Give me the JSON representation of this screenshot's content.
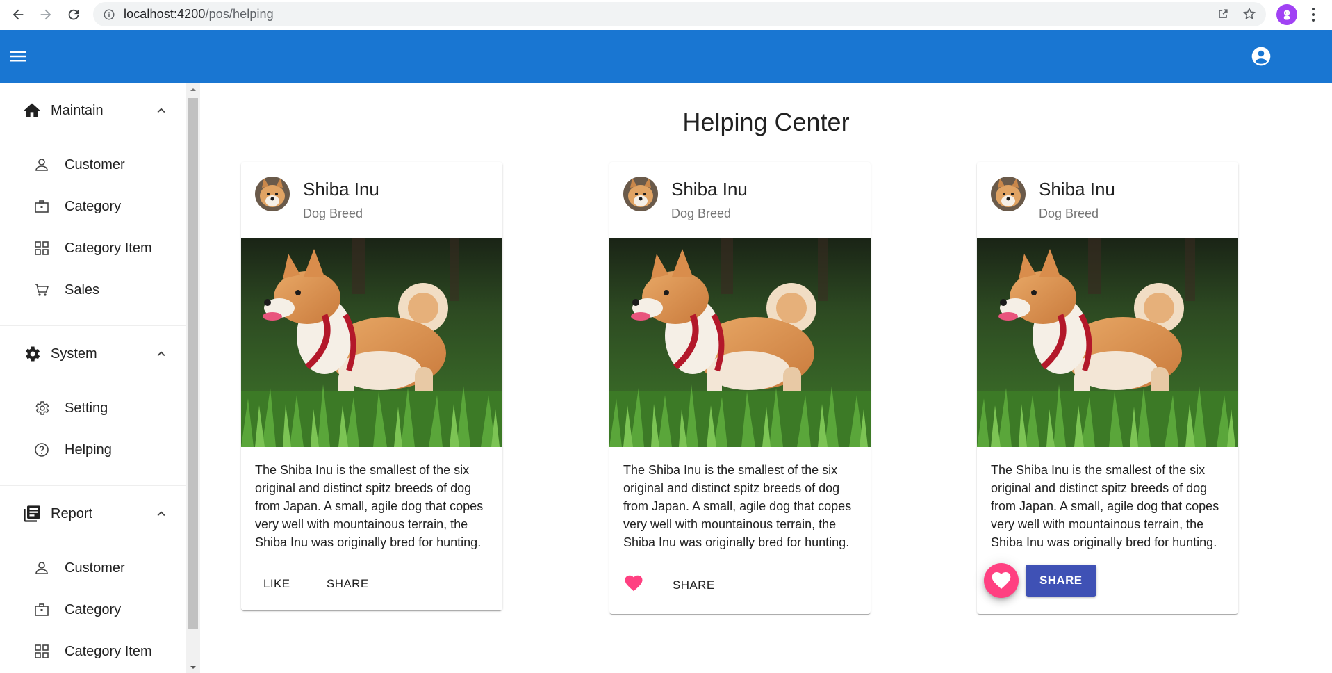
{
  "browser": {
    "url_host": "localhost:4200",
    "url_path": "/pos/helping"
  },
  "app": {
    "toolbar_color": "#1976d2",
    "menu_icon": "menu-icon",
    "account_icon": "account-circle-icon"
  },
  "sidebar": {
    "sections": [
      {
        "label": "Maintain",
        "icon": "home-icon",
        "items": [
          {
            "label": "Customer",
            "icon": "person-icon"
          },
          {
            "label": "Category",
            "icon": "briefcase-icon"
          },
          {
            "label": "Category Item",
            "icon": "grid-icon"
          },
          {
            "label": "Sales",
            "icon": "cart-icon"
          }
        ]
      },
      {
        "label": "System",
        "icon": "settings-icon",
        "items": [
          {
            "label": "Setting",
            "icon": "gear-outline-icon"
          },
          {
            "label": "Helping",
            "icon": "help-circle-icon"
          }
        ]
      },
      {
        "label": "Report",
        "icon": "library-books-icon",
        "items": [
          {
            "label": "Customer",
            "icon": "person-icon"
          },
          {
            "label": "Category",
            "icon": "briefcase-icon"
          },
          {
            "label": "Category Item",
            "icon": "grid-icon"
          }
        ]
      }
    ]
  },
  "main": {
    "title": "Helping Center",
    "cards": [
      {
        "title": "Shiba Inu",
        "subtitle": "Dog Breed",
        "description": "The Shiba Inu is the smallest of the six original and distinct spitz breeds of dog from Japan. A small, agile dog that copes very well with mountainous terrain, the Shiba Inu was originally bred for hunting.",
        "like_label": "LIKE",
        "share_label": "SHARE"
      },
      {
        "title": "Shiba Inu",
        "subtitle": "Dog Breed",
        "description": "The Shiba Inu is the smallest of the six original and distinct spitz breeds of dog from Japan. A small, agile dog that copes very well with mountainous terrain, the Shiba Inu was originally bred for hunting.",
        "like_icon": "heart-icon",
        "share_label": "SHARE"
      },
      {
        "title": "Shiba Inu",
        "subtitle": "Dog Breed",
        "description": "The Shiba Inu is the smallest of the six original and distinct spitz breeds of dog from Japan. A small, agile dog that copes very well with mountainous terrain, the Shiba Inu was originally bred for hunting.",
        "like_icon": "heart-icon",
        "share_label": "SHARE"
      }
    ],
    "accent_pink": "#ff4081",
    "primary_indigo": "#3f51b5"
  }
}
